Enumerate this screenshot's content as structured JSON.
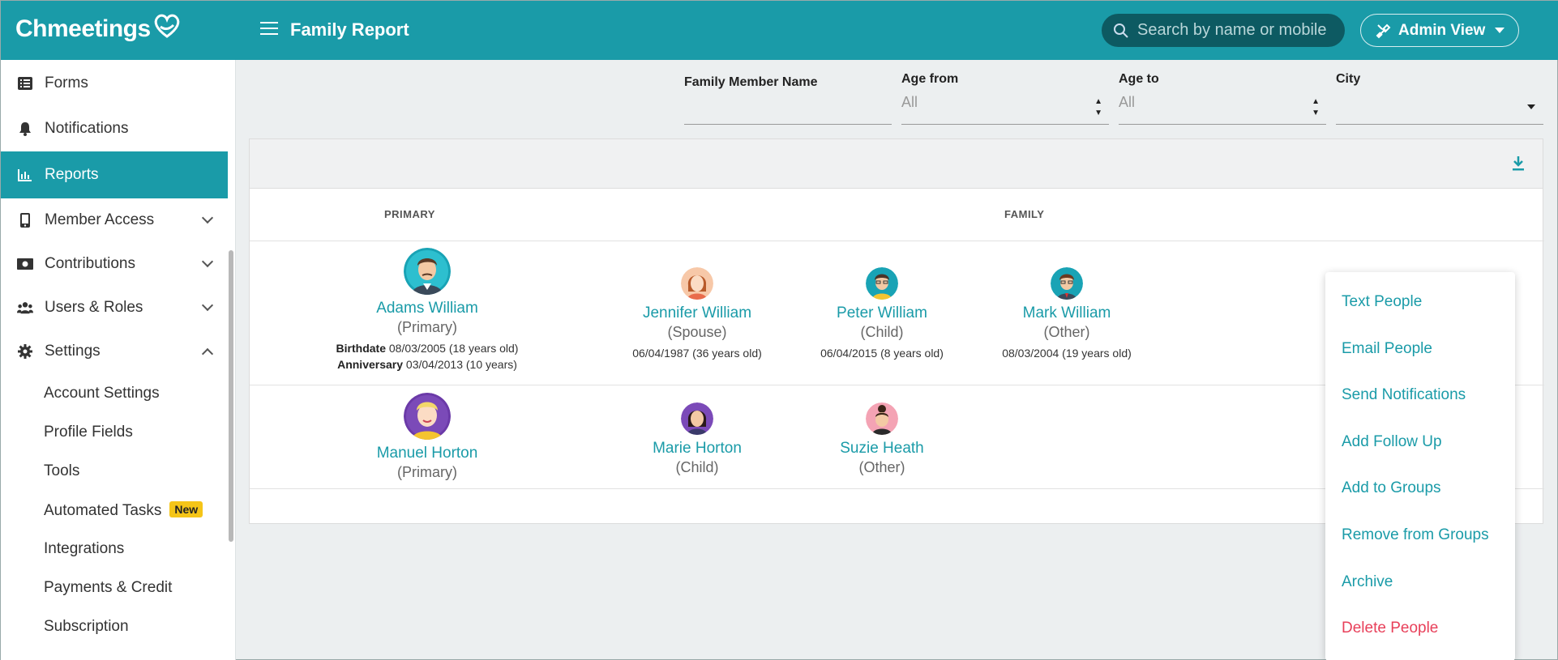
{
  "header": {
    "logo_text": "Chmeetings",
    "title": "Family Report",
    "search_placeholder": "Search by name or mobile",
    "admin_view_label": "Admin View",
    "accent_color": "#1a9ba8"
  },
  "sidebar": {
    "items": [
      {
        "label": "Forms",
        "icon": "forms-icon"
      },
      {
        "label": "Notifications",
        "icon": "bell-icon"
      },
      {
        "label": "Reports",
        "icon": "chart-icon",
        "active": true
      },
      {
        "label": "Member Access",
        "icon": "mobile-icon"
      },
      {
        "label": "Contributions",
        "icon": "money-icon"
      },
      {
        "label": "Users & Roles",
        "icon": "users-icon"
      },
      {
        "label": "Settings",
        "icon": "gear-icon"
      }
    ],
    "sub_items": [
      {
        "label": "Account Settings"
      },
      {
        "label": "Profile Fields"
      },
      {
        "label": "Tools"
      },
      {
        "label": "Automated Tasks",
        "badge": "New"
      },
      {
        "label": "Integrations"
      },
      {
        "label": "Payments & Credit"
      },
      {
        "label": "Subscription"
      }
    ]
  },
  "filters": {
    "family_member_name": {
      "label": "Family Member Name",
      "value": ""
    },
    "age_from": {
      "label": "Age from",
      "value": "All"
    },
    "age_to": {
      "label": "Age to",
      "value": "All"
    },
    "city": {
      "label": "City",
      "value": ""
    }
  },
  "table": {
    "columns": [
      "PRIMARY",
      "FAMILY"
    ],
    "rows": [
      {
        "primary": {
          "name": "Adams William",
          "role": "(Primary)",
          "birthdate_label": "Birthdate",
          "birthdate": "08/03/2005 (18 years old)",
          "anniversary_label": "Anniversary",
          "anniversary": "03/04/2013 (10 years)"
        },
        "family": [
          {
            "name": "Jennifer William",
            "role": "(Spouse)",
            "date": "06/04/1987 (36 years old)"
          },
          {
            "name": "Peter William",
            "role": "(Child)",
            "date": "06/04/2015 (8 years old)"
          },
          {
            "name": "Mark William",
            "role": "(Other)",
            "date": "08/03/2004 (19 years old)"
          }
        ]
      },
      {
        "primary": {
          "name": "Manuel Horton",
          "role": "(Primary)"
        },
        "family": [
          {
            "name": "Marie Horton",
            "role": "(Child)"
          },
          {
            "name": "Suzie Heath",
            "role": "(Other)"
          }
        ]
      }
    ]
  },
  "action_menu": {
    "items": [
      {
        "label": "Text People"
      },
      {
        "label": "Email People"
      },
      {
        "label": "Send Notifications"
      },
      {
        "label": "Add Follow Up"
      },
      {
        "label": "Add to Groups"
      },
      {
        "label": "Remove from Groups"
      },
      {
        "label": "Archive"
      },
      {
        "label": "Delete People",
        "danger": true
      }
    ]
  }
}
